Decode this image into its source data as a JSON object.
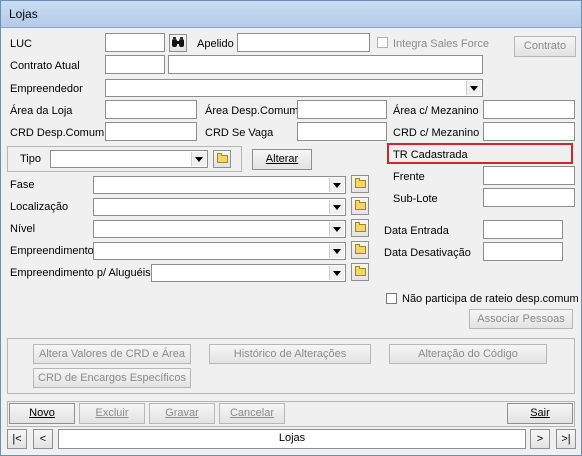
{
  "window": {
    "title": "Lojas"
  },
  "fields": {
    "luc": "LUC",
    "apelido": "Apelido",
    "integra_sales_force": "Integra Sales Force",
    "contrato_btn": "Contrato",
    "contrato_atual": "Contrato Atual",
    "empreendedor": "Empreendedor",
    "area_loja": "Área da Loja",
    "area_desp_comum": "Área Desp.Comum",
    "area_mezanino": "Área c/ Mezanino",
    "crd_desp_comum": "CRD Desp.Comum",
    "crd_se_vaga": "CRD Se Vaga",
    "crd_mezanino": "CRD c/ Mezanino",
    "tr_cadastrada": "TR Cadastrada",
    "tipo": "Tipo",
    "alterar_btn": "Alterar",
    "fase": "Fase",
    "frente": "Frente",
    "localizacao": "Localização",
    "sub_lote": "Sub-Lote",
    "nivel": "Nível",
    "data_entrada": "Data Entrada",
    "empreendimento": "Empreendimento",
    "data_desativacao": "Data Desativação",
    "empreendimento_alugueis": "Empreendimento p/ Aluguéis",
    "nao_participa": "Não participa de rateio desp.comum",
    "associar_pessoas": "Associar Pessoas"
  },
  "actions": {
    "altera_valores": "Altera Valores de CRD e Área",
    "historico": "Histórico de Alterações",
    "alteracao_codigo": "Alteração do Código",
    "crd_encargos": "CRD de Encargos Específicos"
  },
  "footer": {
    "novo": "Novo",
    "excluir": "Excluir",
    "gravar": "Gravar",
    "cancelar": "Cancelar",
    "sair": "Sair",
    "nav_first": "|<",
    "nav_prev": "<",
    "nav_next": ">",
    "nav_last": ">|",
    "record": "Lojas"
  },
  "colors": {
    "highlight_border": "#d9222a"
  }
}
